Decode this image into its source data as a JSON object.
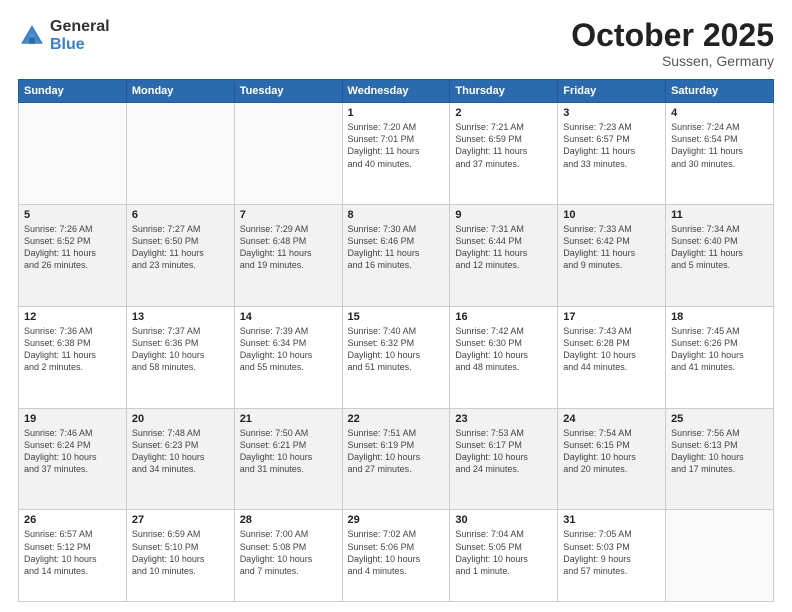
{
  "logo": {
    "general": "General",
    "blue": "Blue"
  },
  "title": "October 2025",
  "subtitle": "Sussen, Germany",
  "days_header": [
    "Sunday",
    "Monday",
    "Tuesday",
    "Wednesday",
    "Thursday",
    "Friday",
    "Saturday"
  ],
  "weeks": [
    {
      "shade": false,
      "days": [
        {
          "num": "",
          "info": ""
        },
        {
          "num": "",
          "info": ""
        },
        {
          "num": "",
          "info": ""
        },
        {
          "num": "1",
          "info": "Sunrise: 7:20 AM\nSunset: 7:01 PM\nDaylight: 11 hours\nand 40 minutes."
        },
        {
          "num": "2",
          "info": "Sunrise: 7:21 AM\nSunset: 6:59 PM\nDaylight: 11 hours\nand 37 minutes."
        },
        {
          "num": "3",
          "info": "Sunrise: 7:23 AM\nSunset: 6:57 PM\nDaylight: 11 hours\nand 33 minutes."
        },
        {
          "num": "4",
          "info": "Sunrise: 7:24 AM\nSunset: 6:54 PM\nDaylight: 11 hours\nand 30 minutes."
        }
      ]
    },
    {
      "shade": true,
      "days": [
        {
          "num": "5",
          "info": "Sunrise: 7:26 AM\nSunset: 6:52 PM\nDaylight: 11 hours\nand 26 minutes."
        },
        {
          "num": "6",
          "info": "Sunrise: 7:27 AM\nSunset: 6:50 PM\nDaylight: 11 hours\nand 23 minutes."
        },
        {
          "num": "7",
          "info": "Sunrise: 7:29 AM\nSunset: 6:48 PM\nDaylight: 11 hours\nand 19 minutes."
        },
        {
          "num": "8",
          "info": "Sunrise: 7:30 AM\nSunset: 6:46 PM\nDaylight: 11 hours\nand 16 minutes."
        },
        {
          "num": "9",
          "info": "Sunrise: 7:31 AM\nSunset: 6:44 PM\nDaylight: 11 hours\nand 12 minutes."
        },
        {
          "num": "10",
          "info": "Sunrise: 7:33 AM\nSunset: 6:42 PM\nDaylight: 11 hours\nand 9 minutes."
        },
        {
          "num": "11",
          "info": "Sunrise: 7:34 AM\nSunset: 6:40 PM\nDaylight: 11 hours\nand 5 minutes."
        }
      ]
    },
    {
      "shade": false,
      "days": [
        {
          "num": "12",
          "info": "Sunrise: 7:36 AM\nSunset: 6:38 PM\nDaylight: 11 hours\nand 2 minutes."
        },
        {
          "num": "13",
          "info": "Sunrise: 7:37 AM\nSunset: 6:36 PM\nDaylight: 10 hours\nand 58 minutes."
        },
        {
          "num": "14",
          "info": "Sunrise: 7:39 AM\nSunset: 6:34 PM\nDaylight: 10 hours\nand 55 minutes."
        },
        {
          "num": "15",
          "info": "Sunrise: 7:40 AM\nSunset: 6:32 PM\nDaylight: 10 hours\nand 51 minutes."
        },
        {
          "num": "16",
          "info": "Sunrise: 7:42 AM\nSunset: 6:30 PM\nDaylight: 10 hours\nand 48 minutes."
        },
        {
          "num": "17",
          "info": "Sunrise: 7:43 AM\nSunset: 6:28 PM\nDaylight: 10 hours\nand 44 minutes."
        },
        {
          "num": "18",
          "info": "Sunrise: 7:45 AM\nSunset: 6:26 PM\nDaylight: 10 hours\nand 41 minutes."
        }
      ]
    },
    {
      "shade": true,
      "days": [
        {
          "num": "19",
          "info": "Sunrise: 7:46 AM\nSunset: 6:24 PM\nDaylight: 10 hours\nand 37 minutes."
        },
        {
          "num": "20",
          "info": "Sunrise: 7:48 AM\nSunset: 6:23 PM\nDaylight: 10 hours\nand 34 minutes."
        },
        {
          "num": "21",
          "info": "Sunrise: 7:50 AM\nSunset: 6:21 PM\nDaylight: 10 hours\nand 31 minutes."
        },
        {
          "num": "22",
          "info": "Sunrise: 7:51 AM\nSunset: 6:19 PM\nDaylight: 10 hours\nand 27 minutes."
        },
        {
          "num": "23",
          "info": "Sunrise: 7:53 AM\nSunset: 6:17 PM\nDaylight: 10 hours\nand 24 minutes."
        },
        {
          "num": "24",
          "info": "Sunrise: 7:54 AM\nSunset: 6:15 PM\nDaylight: 10 hours\nand 20 minutes."
        },
        {
          "num": "25",
          "info": "Sunrise: 7:56 AM\nSunset: 6:13 PM\nDaylight: 10 hours\nand 17 minutes."
        }
      ]
    },
    {
      "shade": false,
      "days": [
        {
          "num": "26",
          "info": "Sunrise: 6:57 AM\nSunset: 5:12 PM\nDaylight: 10 hours\nand 14 minutes."
        },
        {
          "num": "27",
          "info": "Sunrise: 6:59 AM\nSunset: 5:10 PM\nDaylight: 10 hours\nand 10 minutes."
        },
        {
          "num": "28",
          "info": "Sunrise: 7:00 AM\nSunset: 5:08 PM\nDaylight: 10 hours\nand 7 minutes."
        },
        {
          "num": "29",
          "info": "Sunrise: 7:02 AM\nSunset: 5:06 PM\nDaylight: 10 hours\nand 4 minutes."
        },
        {
          "num": "30",
          "info": "Sunrise: 7:04 AM\nSunset: 5:05 PM\nDaylight: 10 hours\nand 1 minute."
        },
        {
          "num": "31",
          "info": "Sunrise: 7:05 AM\nSunset: 5:03 PM\nDaylight: 9 hours\nand 57 minutes."
        },
        {
          "num": "",
          "info": ""
        }
      ]
    }
  ]
}
